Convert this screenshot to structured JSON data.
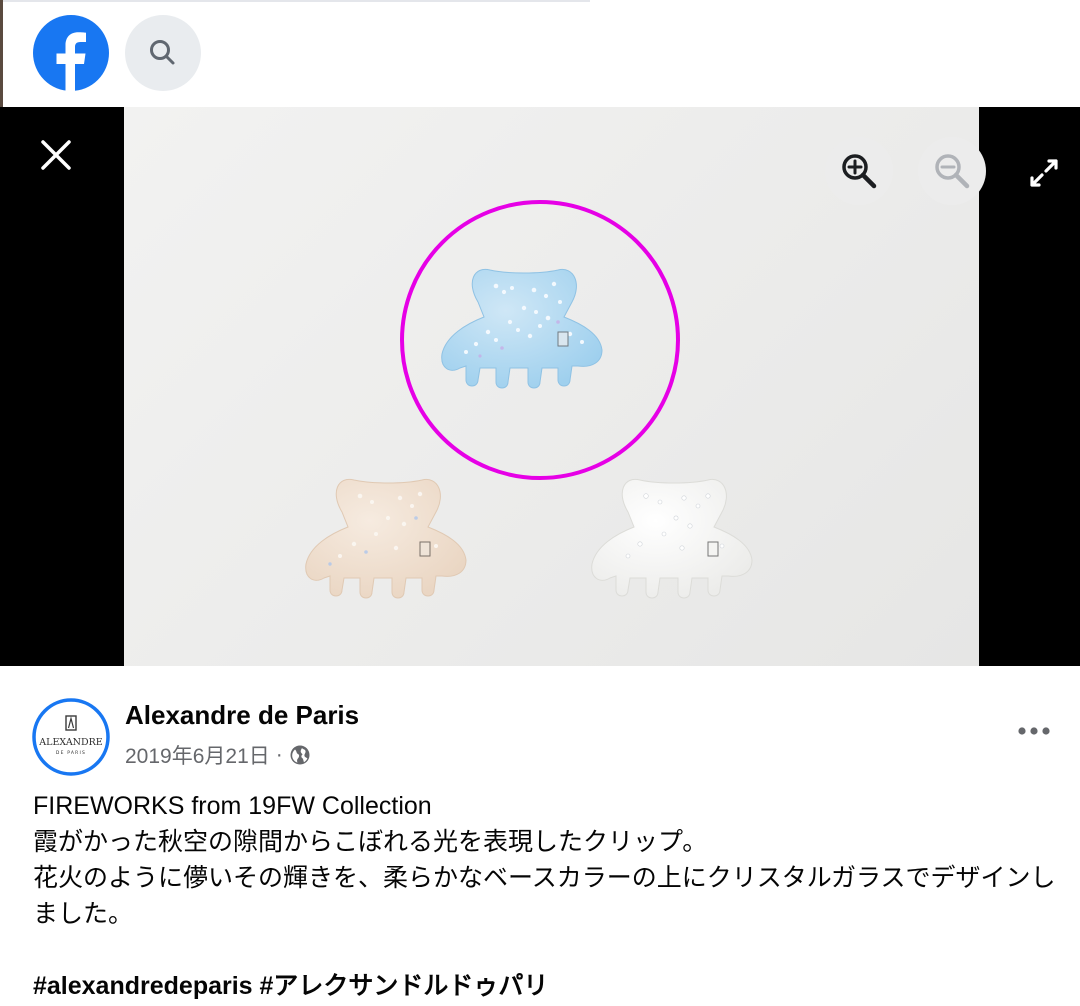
{
  "header": {
    "logo_icon": "facebook-logo-icon",
    "search_icon": "search-icon",
    "brand_color": "#1877f2"
  },
  "viewer": {
    "close_icon": "close-icon",
    "zoom_in_icon": "zoom-in-icon",
    "zoom_out_icon": "zoom-out-icon",
    "fullscreen_icon": "expand-icon",
    "photo": {
      "items": [
        "light blue hair clip",
        "beige hair clip",
        "white hair clip"
      ],
      "highlight_color": "#e600e6"
    }
  },
  "post": {
    "author": "Alexandre de Paris",
    "avatar_text_main": "ALEXANDRE",
    "avatar_text_sub": "DE PARIS",
    "date": "2019年6月21日",
    "separator": "·",
    "privacy_icon": "globe-icon",
    "more_icon": "more-dots-icon",
    "lines": [
      "FIREWORKS from 19FW Collection",
      "霞がかった秋空の隙間からこぼれる光を表現したクリップ。",
      "花火のように儚いその輝きを、柔らかなベースカラーの上にクリスタルガラスでデザインしました。"
    ],
    "hashtags": "#alexandredeparis #アレクサンドルドゥパリ"
  }
}
